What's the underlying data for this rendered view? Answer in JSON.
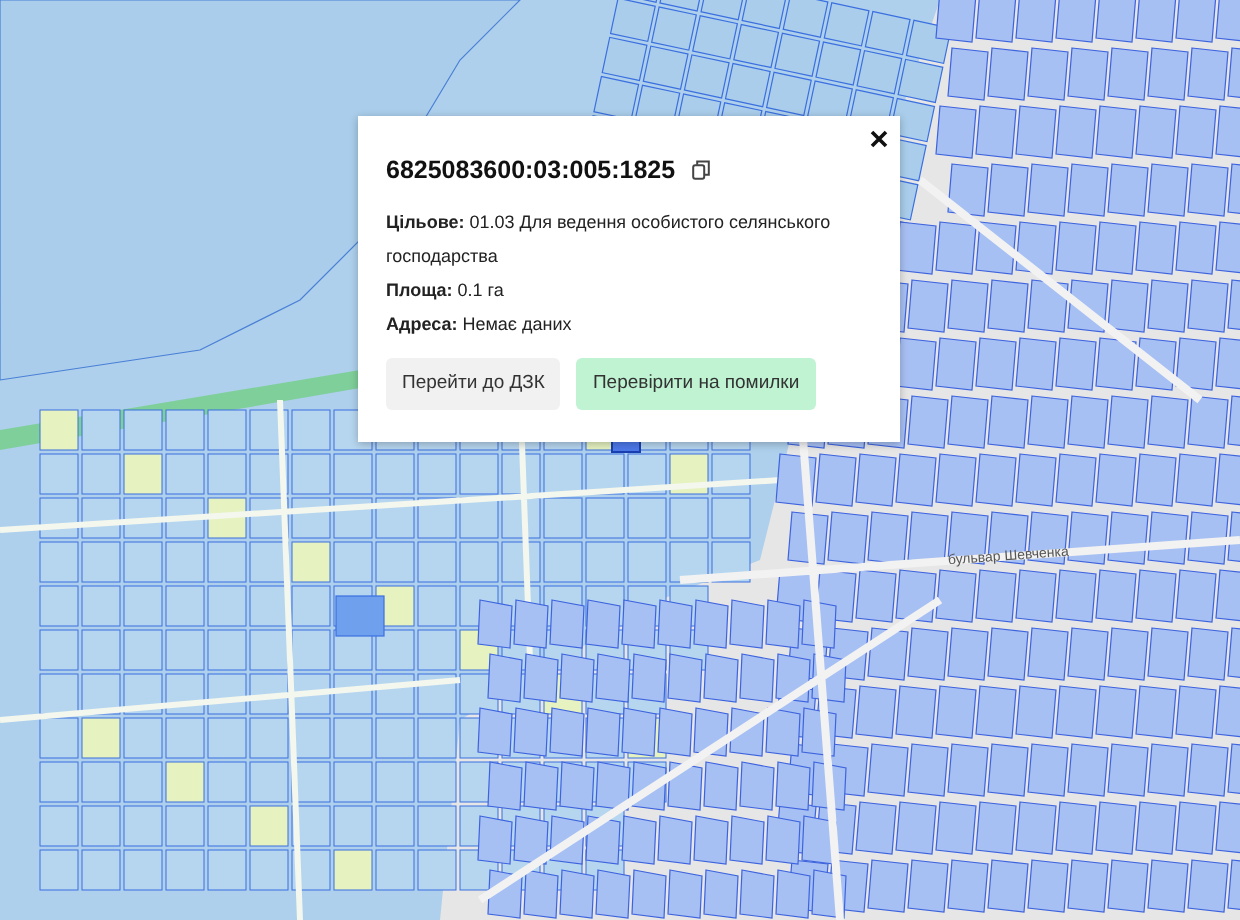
{
  "map": {
    "street_labels": [
      {
        "text": "бульвар Шевченка"
      }
    ]
  },
  "popup": {
    "title": "6825083600:03:005:1825",
    "fields": [
      "**Цільове:** 01.03 Для ведення особистого селянського господарства",
      "**Площа:** 0.1 га",
      "**Адреса:** Немає даних"
    ],
    "buttons": [
      {
        "label": "Перейти до ДЗК",
        "kind": "secondary"
      },
      {
        "label": "Перевірити на помилки",
        "kind": "success"
      }
    ]
  }
}
